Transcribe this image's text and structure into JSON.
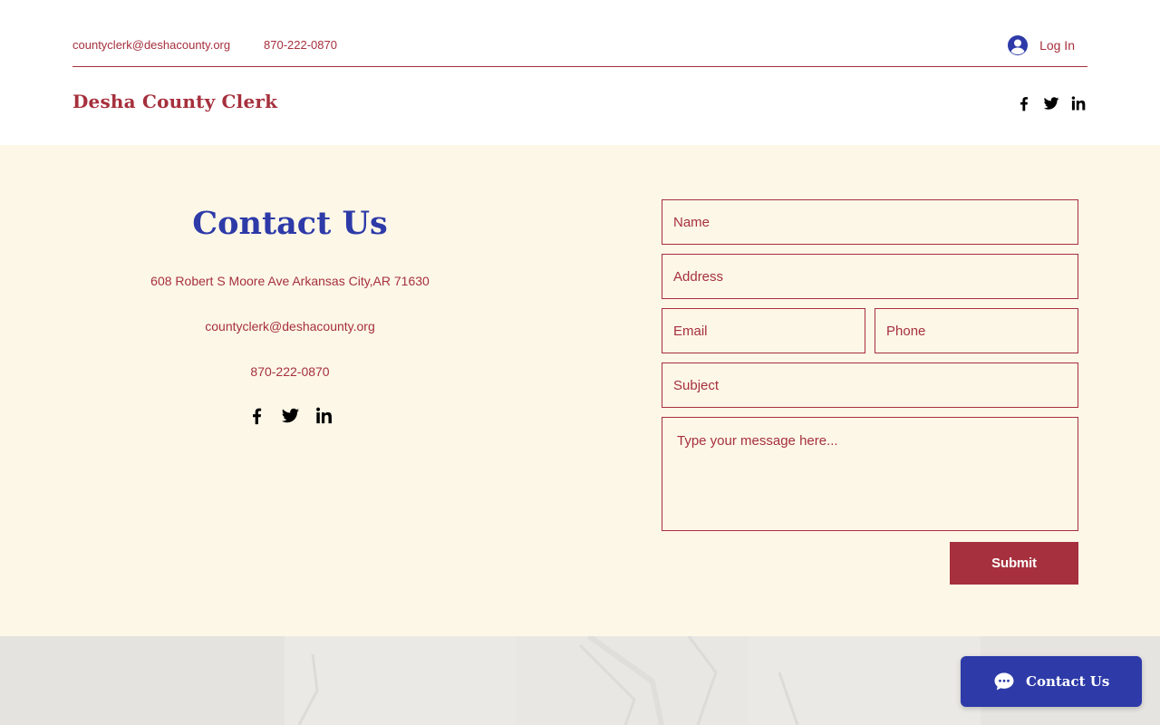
{
  "header": {
    "email": "countyclerk@deshacounty.org",
    "phone": "870-222-0870",
    "login_label": "Log In",
    "site_title": "Desha County Clerk",
    "social_icons": [
      "facebook-icon",
      "twitter-icon",
      "linkedin-icon"
    ]
  },
  "contact": {
    "title": "Contact Us",
    "address": "608 Robert S Moore Ave Arkansas City,AR 71630",
    "email": "countyclerk@deshacounty.org",
    "phone": "870-222-0870",
    "social_icons": [
      "facebook-icon",
      "twitter-icon",
      "linkedin-icon"
    ]
  },
  "form": {
    "name_placeholder": "Name",
    "address_placeholder": "Address",
    "email_placeholder": "Email",
    "phone_placeholder": "Phone",
    "subject_placeholder": "Subject",
    "message_placeholder": "Type your message here...",
    "submit_label": "Submit"
  },
  "chat": {
    "label": "Contact Us"
  },
  "colors": {
    "accent_red": "#a6303d",
    "accent_blue": "#2d3aa8",
    "section_bg": "#fdf7e8",
    "map_bg": "#e8e6e3"
  }
}
